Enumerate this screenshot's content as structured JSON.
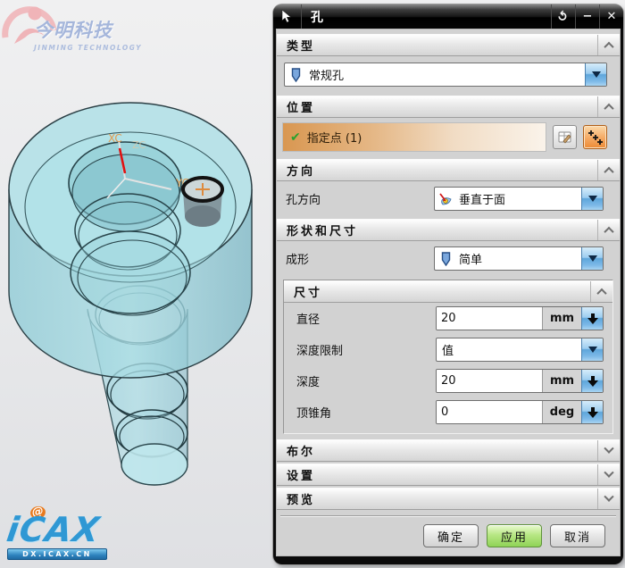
{
  "watermark": {
    "name": "今明科技",
    "subtitle": "JINMING TECHNOLOGY"
  },
  "icax_badge": {
    "wordmark": "iCAX",
    "at_sign": "@",
    "url_text": "DX.ICAX.CN"
  },
  "viewport": {
    "axis_triad": {
      "x_label": "XC",
      "y_label": "YC",
      "z_label": "ZC"
    }
  },
  "icons": {
    "reset": "↺",
    "minimize": "−",
    "close": "✕",
    "check": "✔"
  },
  "dialog": {
    "title": "孔",
    "type_section": {
      "header": "类型",
      "dropdown_value": "常规孔"
    },
    "position_section": {
      "header": "位置",
      "specify_point_label": "指定点 (1)"
    },
    "direction_section": {
      "header": "方向",
      "hole_direction_label": "孔方向",
      "hole_direction_value": "垂直于面"
    },
    "shape_section": {
      "header": "形状和尺寸",
      "form_label": "成形",
      "form_value": "简单"
    },
    "dimensions": {
      "header": "尺寸",
      "diameter": {
        "label": "直径",
        "value": "20",
        "unit": "mm"
      },
      "depth_limit": {
        "label": "深度限制",
        "value": "值"
      },
      "depth": {
        "label": "深度",
        "value": "20",
        "unit": "mm"
      },
      "tip_angle": {
        "label": "顶锥角",
        "value": "0",
        "unit": "deg"
      }
    },
    "boolean_section": {
      "header": "布尔"
    },
    "settings_section": {
      "header": "设置"
    },
    "preview_section": {
      "header": "预览"
    },
    "footer": {
      "ok": "确定",
      "apply": "应用",
      "cancel": "取消"
    }
  },
  "colors": {
    "selection_orange": "#d99751",
    "apply_green": "#8fd356",
    "dropdown_blue": "#7db9e8",
    "model_teal": "#9fd6dd",
    "axis_orange": "#e09a50"
  }
}
